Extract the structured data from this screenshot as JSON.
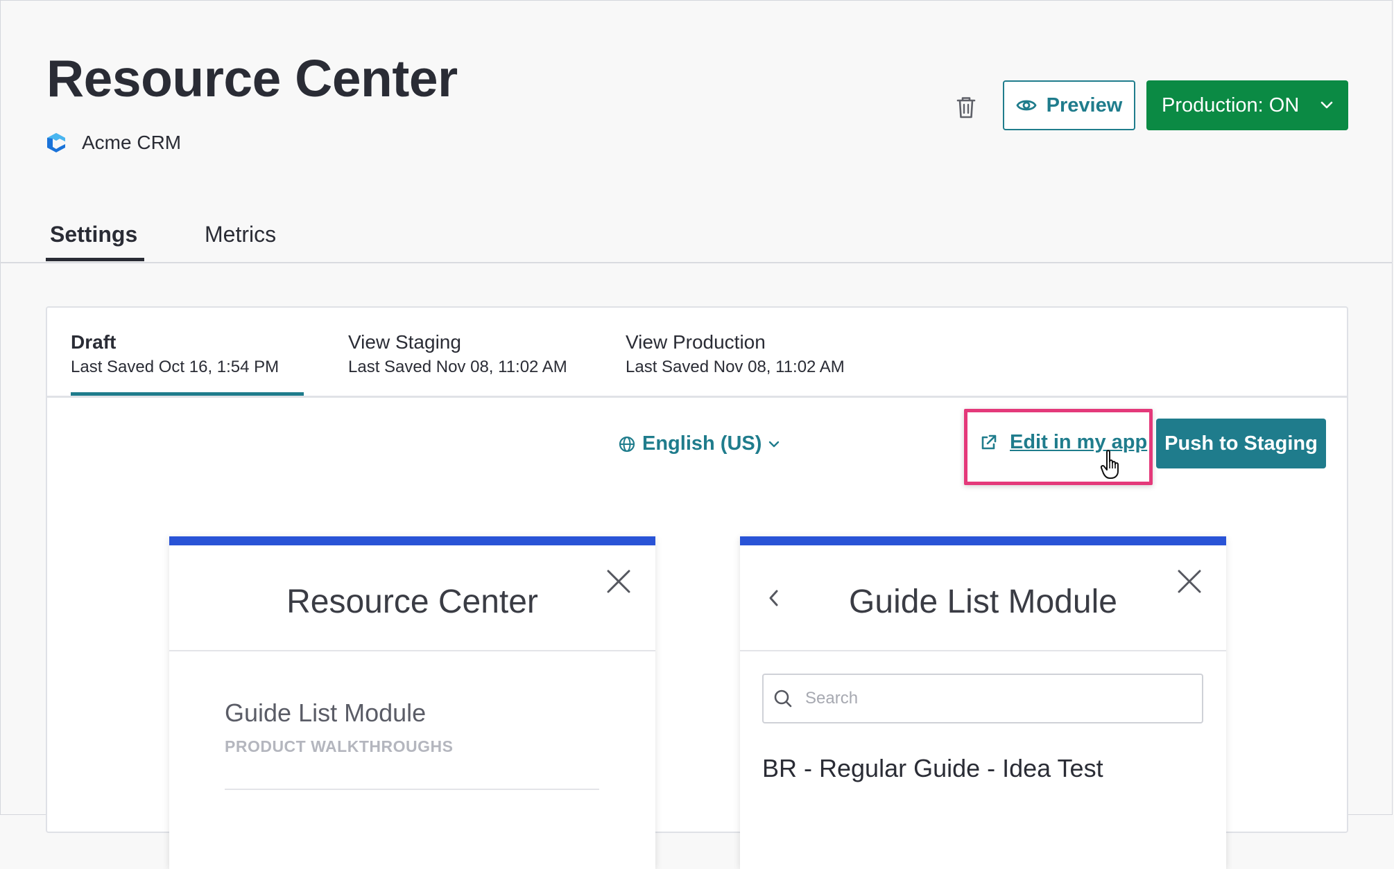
{
  "header": {
    "title": "Resource Center",
    "app_name": "Acme CRM",
    "preview_label": "Preview",
    "production_label": "Production: ON"
  },
  "tabs": [
    {
      "label": "Settings",
      "active": true
    },
    {
      "label": "Metrics",
      "active": false
    }
  ],
  "environments": [
    {
      "title": "Draft",
      "subtitle": "Last Saved Oct 16, 1:54 PM",
      "active": true
    },
    {
      "title": "View Staging",
      "subtitle": "Last Saved Nov 08, 11:02 AM",
      "active": false
    },
    {
      "title": "View Production",
      "subtitle": "Last Saved Nov 08, 11:02 AM",
      "active": false
    }
  ],
  "toolbar": {
    "language": "English (US)",
    "edit_label": "Edit in my app",
    "push_label": "Push to Staging"
  },
  "preview_left": {
    "title": "Resource Center",
    "module_title": "Guide List Module",
    "module_subtitle": "PRODUCT WALKTHROUGHS"
  },
  "preview_right": {
    "title": "Guide List Module",
    "search_placeholder": "Search",
    "items": [
      "BR - Regular Guide - Idea Test"
    ]
  },
  "colors": {
    "accent": "#1f7c8c",
    "production_green": "#0b8a44",
    "card_top_bar": "#2953d6",
    "highlight": "#e4397a"
  }
}
